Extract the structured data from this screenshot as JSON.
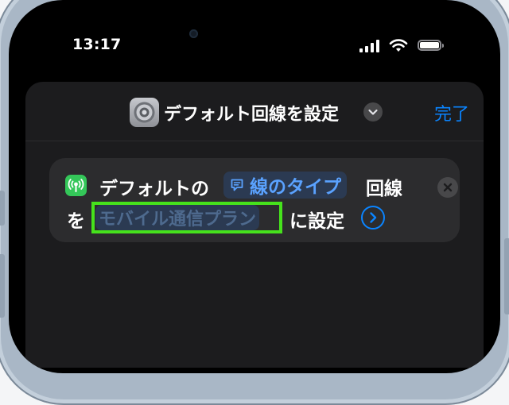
{
  "status_bar": {
    "time": "13:17"
  },
  "nav": {
    "title": "デフォルト回線を設定",
    "done_label": "完了"
  },
  "action": {
    "prefix": "デフォルトの",
    "line_type_param": "線のタイプ",
    "line_word": "回線",
    "wo": "を",
    "plan_param": "モバイル通信プラン",
    "suffix": "に設定"
  },
  "colors": {
    "accent": "#0a84ff",
    "highlight": "#46e21c",
    "cellular_icon": "#34c759",
    "background": "#000000",
    "sheet": "#1c1c1e",
    "card": "#2c2c2e"
  },
  "icons": {
    "settings": "settings-app-icon",
    "dropdown": "chevron-down-icon",
    "cellular": "cellular-antenna-icon",
    "parameter": "speech-bubble-icon",
    "remove": "close-icon",
    "expand": "chevron-right-icon"
  }
}
